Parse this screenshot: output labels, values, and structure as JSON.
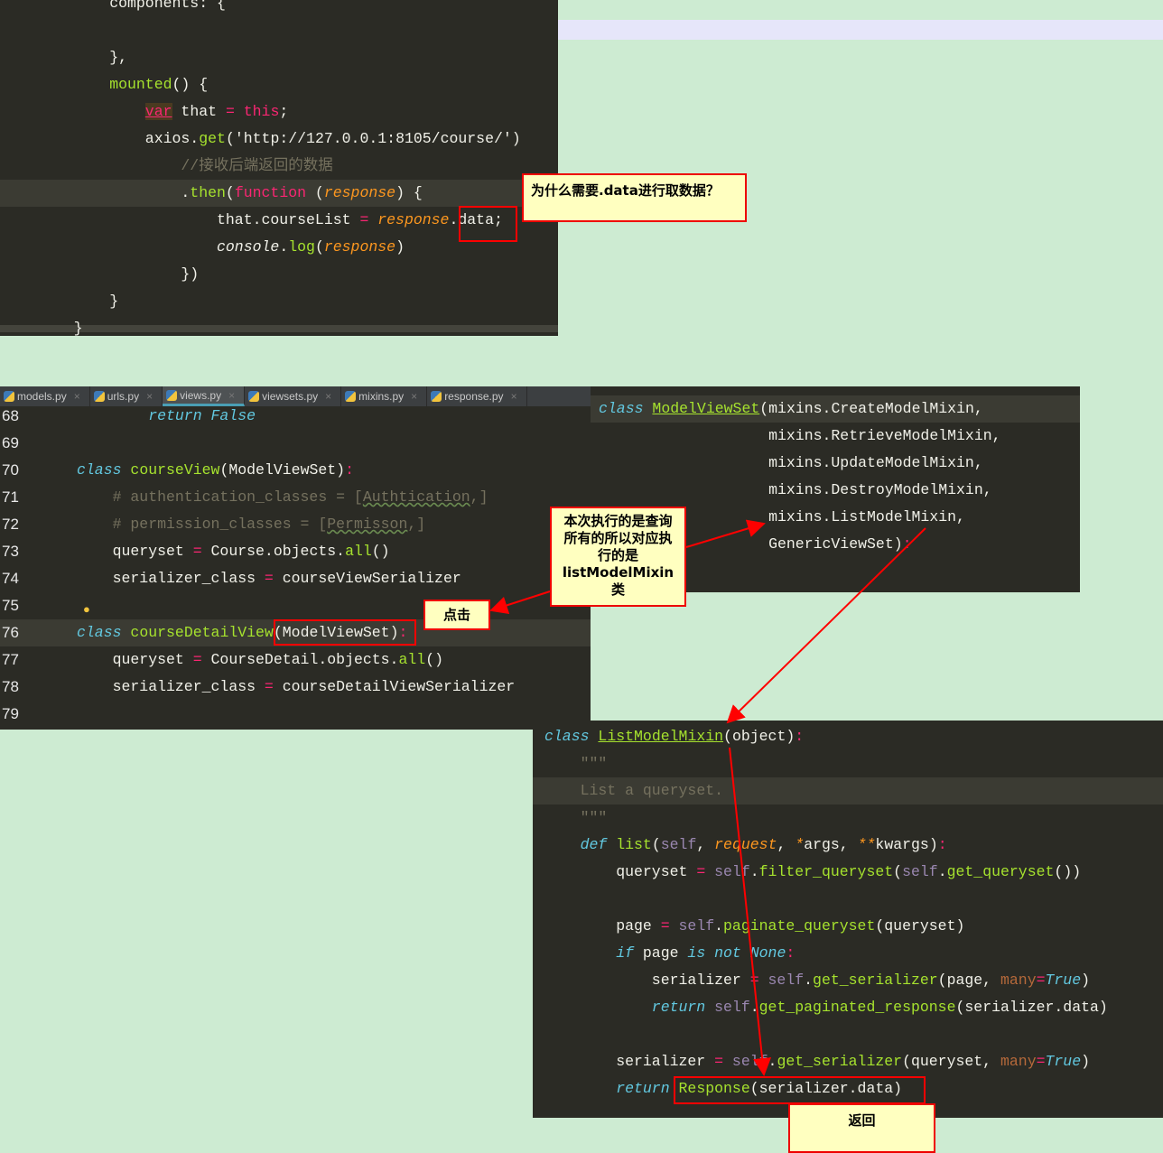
{
  "top_panel": {
    "lines": [
      {
        "indent": 8,
        "t": [
          [
            "components: {",
            "w"
          ]
        ]
      },
      {
        "indent": 0,
        "t": []
      },
      {
        "indent": 8,
        "t": [
          [
            "},",
            "w"
          ]
        ]
      },
      {
        "indent": 8,
        "t": [
          [
            "mounted",
            "g"
          ],
          [
            "() {",
            "w"
          ]
        ]
      },
      {
        "indent": 12,
        "t": [
          [
            "var",
            "v"
          ],
          [
            " that ",
            "w"
          ],
          [
            "=",
            "o"
          ],
          [
            " ",
            "w"
          ],
          [
            "this",
            "o"
          ],
          [
            ";",
            "w"
          ]
        ]
      },
      {
        "indent": 12,
        "t": [
          [
            "axios.",
            "w"
          ],
          [
            "get",
            "g"
          ],
          [
            "('http://127.0.0.1:8105/course/')",
            "w"
          ]
        ]
      },
      {
        "indent": 16,
        "t": [
          [
            "//接收后端返回的数据",
            "c"
          ]
        ]
      },
      {
        "indent": 16,
        "hl": true,
        "t": [
          [
            ".",
            "w"
          ],
          [
            "then",
            "g"
          ],
          [
            "(",
            "w"
          ],
          [
            "function",
            "o"
          ],
          [
            " (",
            "w"
          ],
          [
            "response",
            "p"
          ],
          [
            ") {",
            "w"
          ]
        ]
      },
      {
        "indent": 20,
        "t": [
          [
            "that.courseList ",
            "w"
          ],
          [
            "=",
            "o"
          ],
          [
            " ",
            "w"
          ],
          [
            "response",
            "p"
          ],
          [
            ".data;",
            "w"
          ]
        ]
      },
      {
        "indent": 20,
        "t": [
          [
            "console",
            "i"
          ],
          [
            ".",
            "w"
          ],
          [
            "log",
            "g"
          ],
          [
            "(",
            "w"
          ],
          [
            "response",
            "p"
          ],
          [
            ")",
            "w"
          ]
        ]
      },
      {
        "indent": 16,
        "t": [
          [
            "})",
            "w"
          ]
        ]
      },
      {
        "indent": 8,
        "t": [
          [
            "}",
            "w"
          ]
        ]
      },
      {
        "indent": 4,
        "t": [
          [
            "}",
            "w"
          ]
        ]
      }
    ]
  },
  "views_panel": {
    "tabs": [
      {
        "label": "models.py"
      },
      {
        "label": "urls.py"
      },
      {
        "label": "views.py",
        "active": true
      },
      {
        "label": "viewsets.py"
      },
      {
        "label": "mixins.py"
      },
      {
        "label": "response.py"
      }
    ],
    "lines": [
      {
        "n": "68",
        "indent": 8,
        "t": [
          [
            "return False",
            "k"
          ]
        ]
      },
      {
        "n": "69",
        "indent": 0,
        "t": []
      },
      {
        "n": "70",
        "indent": 0,
        "t": [
          [
            "class",
            "k"
          ],
          [
            " ",
            "w"
          ],
          [
            "courseView",
            "g"
          ],
          [
            "(ModelViewSet)",
            "w"
          ],
          [
            ":",
            "o"
          ]
        ]
      },
      {
        "n": "71",
        "indent": 4,
        "t": [
          [
            "# authentication_classes = [",
            "c"
          ],
          [
            "Authtication",
            "cu"
          ],
          [
            ",]",
            "c"
          ]
        ]
      },
      {
        "n": "72",
        "indent": 4,
        "t": [
          [
            "# permission_classes = [",
            "c"
          ],
          [
            "Permisson",
            "cu"
          ],
          [
            ",]",
            "c"
          ]
        ]
      },
      {
        "n": "73",
        "indent": 4,
        "t": [
          [
            "queryset ",
            "w"
          ],
          [
            "=",
            "o"
          ],
          [
            " Course.objects.",
            "w"
          ],
          [
            "all",
            "g"
          ],
          [
            "()",
            "w"
          ]
        ]
      },
      {
        "n": "74",
        "indent": 4,
        "t": [
          [
            "serializer_class ",
            "w"
          ],
          [
            "=",
            "o"
          ],
          [
            " courseViewSerializer",
            "w"
          ]
        ]
      },
      {
        "n": "75",
        "indent": 0,
        "t": []
      },
      {
        "n": "76",
        "indent": 0,
        "hl": true,
        "t": [
          [
            "class",
            "k"
          ],
          [
            " ",
            "w"
          ],
          [
            "courseDetailView",
            "g"
          ],
          [
            "(ModelViewSet)",
            "w"
          ],
          [
            ":",
            "o"
          ]
        ]
      },
      {
        "n": "77",
        "indent": 4,
        "t": [
          [
            "queryset ",
            "w"
          ],
          [
            "=",
            "o"
          ],
          [
            " CourseDetail.objects.",
            "w"
          ],
          [
            "all",
            "g"
          ],
          [
            "()",
            "w"
          ]
        ]
      },
      {
        "n": "78",
        "indent": 4,
        "t": [
          [
            "serializer_class ",
            "w"
          ],
          [
            "=",
            "o"
          ],
          [
            " courseDetailViewSerializer",
            "w"
          ]
        ]
      },
      {
        "n": "79",
        "indent": 0,
        "t": []
      }
    ]
  },
  "modelviewset_panel": {
    "lines": [
      {
        "indent": 0,
        "hl": true,
        "t": [
          [
            "class",
            "k"
          ],
          [
            " ",
            "w"
          ],
          [
            "ModelViewSet",
            "u"
          ],
          [
            "(mixins.CreateModelMixin,",
            "w"
          ]
        ]
      },
      {
        "indent": 19,
        "t": [
          [
            "mixins.RetrieveModelMixin,",
            "w"
          ]
        ]
      },
      {
        "indent": 19,
        "t": [
          [
            "mixins.UpdateModelMixin,",
            "w"
          ]
        ]
      },
      {
        "indent": 19,
        "t": [
          [
            "mixins.DestroyModelMixin,",
            "w"
          ]
        ]
      },
      {
        "indent": 19,
        "t": [
          [
            "mixins.ListModelMixin,",
            "w"
          ]
        ]
      },
      {
        "indent": 19,
        "t": [
          [
            "GenericViewSet)",
            "w"
          ],
          [
            ":",
            "o"
          ]
        ]
      }
    ]
  },
  "listmixin_panel": {
    "lines": [
      {
        "indent": 0,
        "t": [
          [
            "class",
            "k"
          ],
          [
            " ",
            "w"
          ],
          [
            "ListModelMixin",
            "u"
          ],
          [
            "(object)",
            "w"
          ],
          [
            ":",
            "o"
          ]
        ]
      },
      {
        "indent": 4,
        "t": [
          [
            "\"\"\"",
            "c"
          ]
        ]
      },
      {
        "indent": 4,
        "hl": true,
        "t": [
          [
            "List a queryset.",
            "c"
          ]
        ]
      },
      {
        "indent": 4,
        "t": [
          [
            "\"\"\"",
            "c"
          ]
        ]
      },
      {
        "indent": 4,
        "t": [
          [
            "def",
            "k"
          ],
          [
            " ",
            "w"
          ],
          [
            "list",
            "g"
          ],
          [
            "(",
            "w"
          ],
          [
            "self",
            "s"
          ],
          [
            ", ",
            "w"
          ],
          [
            "request",
            "p"
          ],
          [
            ", ",
            "w"
          ],
          [
            "*",
            "p"
          ],
          [
            "args, ",
            "w"
          ],
          [
            "**",
            "p"
          ],
          [
            "kwargs)",
            "w"
          ],
          [
            ":",
            "o"
          ]
        ]
      },
      {
        "indent": 8,
        "t": [
          [
            "queryset ",
            "w"
          ],
          [
            "=",
            "o"
          ],
          [
            " ",
            "w"
          ],
          [
            "self",
            "s"
          ],
          [
            ".",
            "w"
          ],
          [
            "filter_queryset",
            "g"
          ],
          [
            "(",
            "w"
          ],
          [
            "self",
            "s"
          ],
          [
            ".",
            "w"
          ],
          [
            "get_queryset",
            "g"
          ],
          [
            "())",
            "w"
          ]
        ]
      },
      {
        "indent": 0,
        "t": []
      },
      {
        "indent": 8,
        "t": [
          [
            "page ",
            "w"
          ],
          [
            "=",
            "o"
          ],
          [
            " ",
            "w"
          ],
          [
            "self",
            "s"
          ],
          [
            ".",
            "w"
          ],
          [
            "paginate_queryset",
            "g"
          ],
          [
            "(queryset)",
            "w"
          ]
        ]
      },
      {
        "indent": 8,
        "t": [
          [
            "if",
            "k"
          ],
          [
            " page ",
            "w"
          ],
          [
            "is not None",
            "k"
          ],
          [
            ":",
            "o"
          ]
        ]
      },
      {
        "indent": 12,
        "t": [
          [
            "serializer ",
            "w"
          ],
          [
            "=",
            "o"
          ],
          [
            " ",
            "w"
          ],
          [
            "self",
            "s"
          ],
          [
            ".",
            "w"
          ],
          [
            "get_serializer",
            "g"
          ],
          [
            "(page, ",
            "w"
          ],
          [
            "many",
            "m"
          ],
          [
            "=",
            "o"
          ],
          [
            "True",
            "k"
          ],
          [
            ")",
            "w"
          ]
        ]
      },
      {
        "indent": 12,
        "t": [
          [
            "return",
            "k"
          ],
          [
            " ",
            "w"
          ],
          [
            "self",
            "s"
          ],
          [
            ".",
            "w"
          ],
          [
            "get_paginated_response",
            "g"
          ],
          [
            "(serializer.data)",
            "w"
          ]
        ]
      },
      {
        "indent": 0,
        "t": []
      },
      {
        "indent": 8,
        "t": [
          [
            "serializer ",
            "w"
          ],
          [
            "=",
            "o"
          ],
          [
            " ",
            "w"
          ],
          [
            "self",
            "s"
          ],
          [
            ".",
            "w"
          ],
          [
            "get_serializer",
            "g"
          ],
          [
            "(queryset, ",
            "w"
          ],
          [
            "many",
            "m"
          ],
          [
            "=",
            "o"
          ],
          [
            "True",
            "k"
          ],
          [
            ")",
            "w"
          ]
        ]
      },
      {
        "indent": 8,
        "t": [
          [
            "return",
            "k"
          ],
          [
            " ",
            "w"
          ],
          [
            "Response",
            "g"
          ],
          [
            "(serializer.data)",
            "w"
          ]
        ]
      }
    ]
  },
  "callouts": {
    "why_data": "为什么需要.data进行取数据？",
    "list_mixin": "本次执行的是查询所有的所以对应执行的是listModelMixin类",
    "click": "点击",
    "return": "返回"
  },
  "colors": {
    "background": "#cdebd2",
    "editor": "#2b2b25",
    "annotation": "#ff0000",
    "callout": "#ffffc0"
  }
}
